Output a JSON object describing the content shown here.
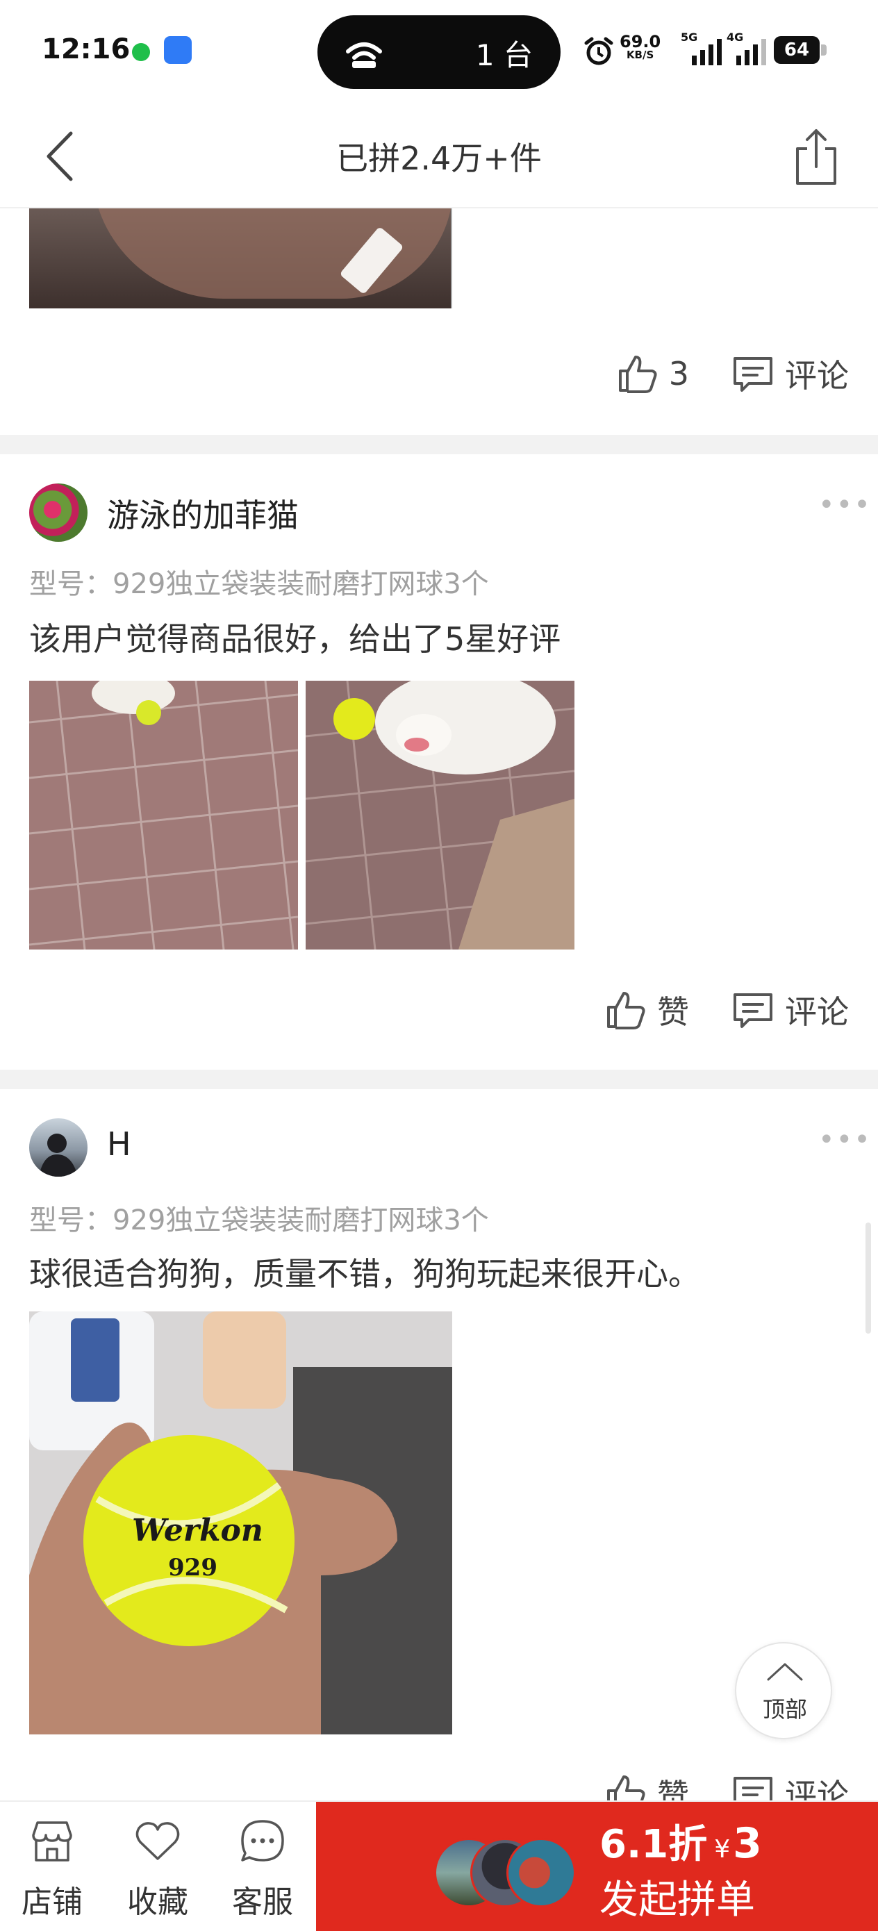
{
  "status_bar": {
    "time": "12:16",
    "pill_text": "1 台",
    "net_speed": "69.0",
    "net_speed_unit": "KB/S",
    "net1": "5G",
    "net2": "4G",
    "battery": "64"
  },
  "nav": {
    "title": "已拼2.4万+件"
  },
  "reviews": [
    {
      "like_label": "3",
      "comment_label": "评论"
    },
    {
      "username": "游泳的加菲猫",
      "model": "型号：929独立袋装装耐磨打网球3个",
      "text": "该用户觉得商品很好，给出了5星好评",
      "like_label": "赞",
      "comment_label": "评论"
    },
    {
      "username": "H",
      "model": "型号：929独立袋装装耐磨打网球3个",
      "text": "球很适合狗狗，质量不错，狗狗玩起来很开心。",
      "ball_brand": "Werkon",
      "ball_number": "929",
      "like_label": "赞",
      "comment_label": "评论"
    }
  ],
  "more_label": "•••",
  "to_top_label": "顶部",
  "bottom_bar": {
    "store_label": "店铺",
    "favorite_label": "收藏",
    "service_label": "客服",
    "discount": "6.1折",
    "currency": "¥",
    "price": "3",
    "cta_label": "发起拼单"
  },
  "colors": {
    "cta_red": "#e0291e",
    "muted_text": "#a0a0a0"
  }
}
